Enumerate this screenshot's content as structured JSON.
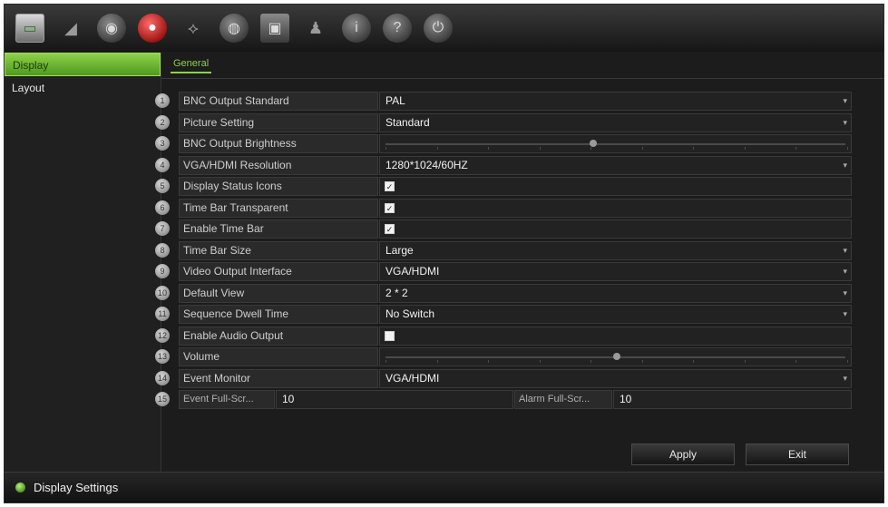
{
  "toolbar": {
    "icons": [
      {
        "name": "display-icon",
        "glyph": "▭"
      },
      {
        "name": "camera-icon",
        "glyph": "◢"
      },
      {
        "name": "network-icon",
        "glyph": "◉"
      },
      {
        "name": "record-icon",
        "glyph": "●"
      },
      {
        "name": "alarm-icon",
        "glyph": "⟡"
      },
      {
        "name": "device-icon",
        "glyph": "◍"
      },
      {
        "name": "storage-icon",
        "glyph": "▣"
      },
      {
        "name": "user-icon",
        "glyph": "♟"
      },
      {
        "name": "info-icon",
        "glyph": "i"
      },
      {
        "name": "help-icon",
        "glyph": "?"
      },
      {
        "name": "power-icon",
        "glyph": "⏻"
      }
    ]
  },
  "sidebar": {
    "items": [
      {
        "label": "Display",
        "selected": true
      },
      {
        "label": "Layout",
        "selected": false
      }
    ]
  },
  "tabs": [
    {
      "label": "General",
      "active": true
    }
  ],
  "settings": {
    "rows": [
      {
        "num": "1",
        "label": "BNC Output Standard",
        "type": "select",
        "value": "PAL"
      },
      {
        "num": "2",
        "label": "Picture Setting",
        "type": "select",
        "value": "Standard"
      },
      {
        "num": "3",
        "label": "BNC Output Brightness",
        "type": "slider",
        "level": 0.45
      },
      {
        "num": "4",
        "label": "VGA/HDMI Resolution",
        "type": "select",
        "value": "1280*1024/60HZ"
      },
      {
        "num": "5",
        "label": "Display Status Icons",
        "type": "checkbox",
        "checked": true
      },
      {
        "num": "6",
        "label": "Time Bar Transparent",
        "type": "checkbox",
        "checked": true
      },
      {
        "num": "7",
        "label": "Enable Time Bar",
        "type": "checkbox",
        "checked": true
      },
      {
        "num": "8",
        "label": "Time Bar Size",
        "type": "select",
        "value": "Large"
      },
      {
        "num": "9",
        "label": "Video Output Interface",
        "type": "select",
        "value": "VGA/HDMI"
      },
      {
        "num": "10",
        "label": "Default View",
        "type": "select",
        "value": "2 * 2"
      },
      {
        "num": "11",
        "label": "Sequence Dwell Time",
        "type": "select",
        "value": "No Switch"
      },
      {
        "num": "12",
        "label": "Enable Audio Output",
        "type": "checkbox",
        "checked": false
      },
      {
        "num": "13",
        "label": "Volume",
        "type": "slider",
        "level": 0.5
      },
      {
        "num": "14",
        "label": "Event Monitor",
        "type": "select",
        "value": "VGA/HDMI"
      },
      {
        "num": "15",
        "type": "pair",
        "label1": "Event Full-Scr...",
        "value1": "10",
        "label2": "Alarm Full-Scr...",
        "value2": "10"
      }
    ]
  },
  "buttons": {
    "apply": "Apply",
    "exit": "Exit"
  },
  "status": {
    "text": "Display Settings"
  }
}
